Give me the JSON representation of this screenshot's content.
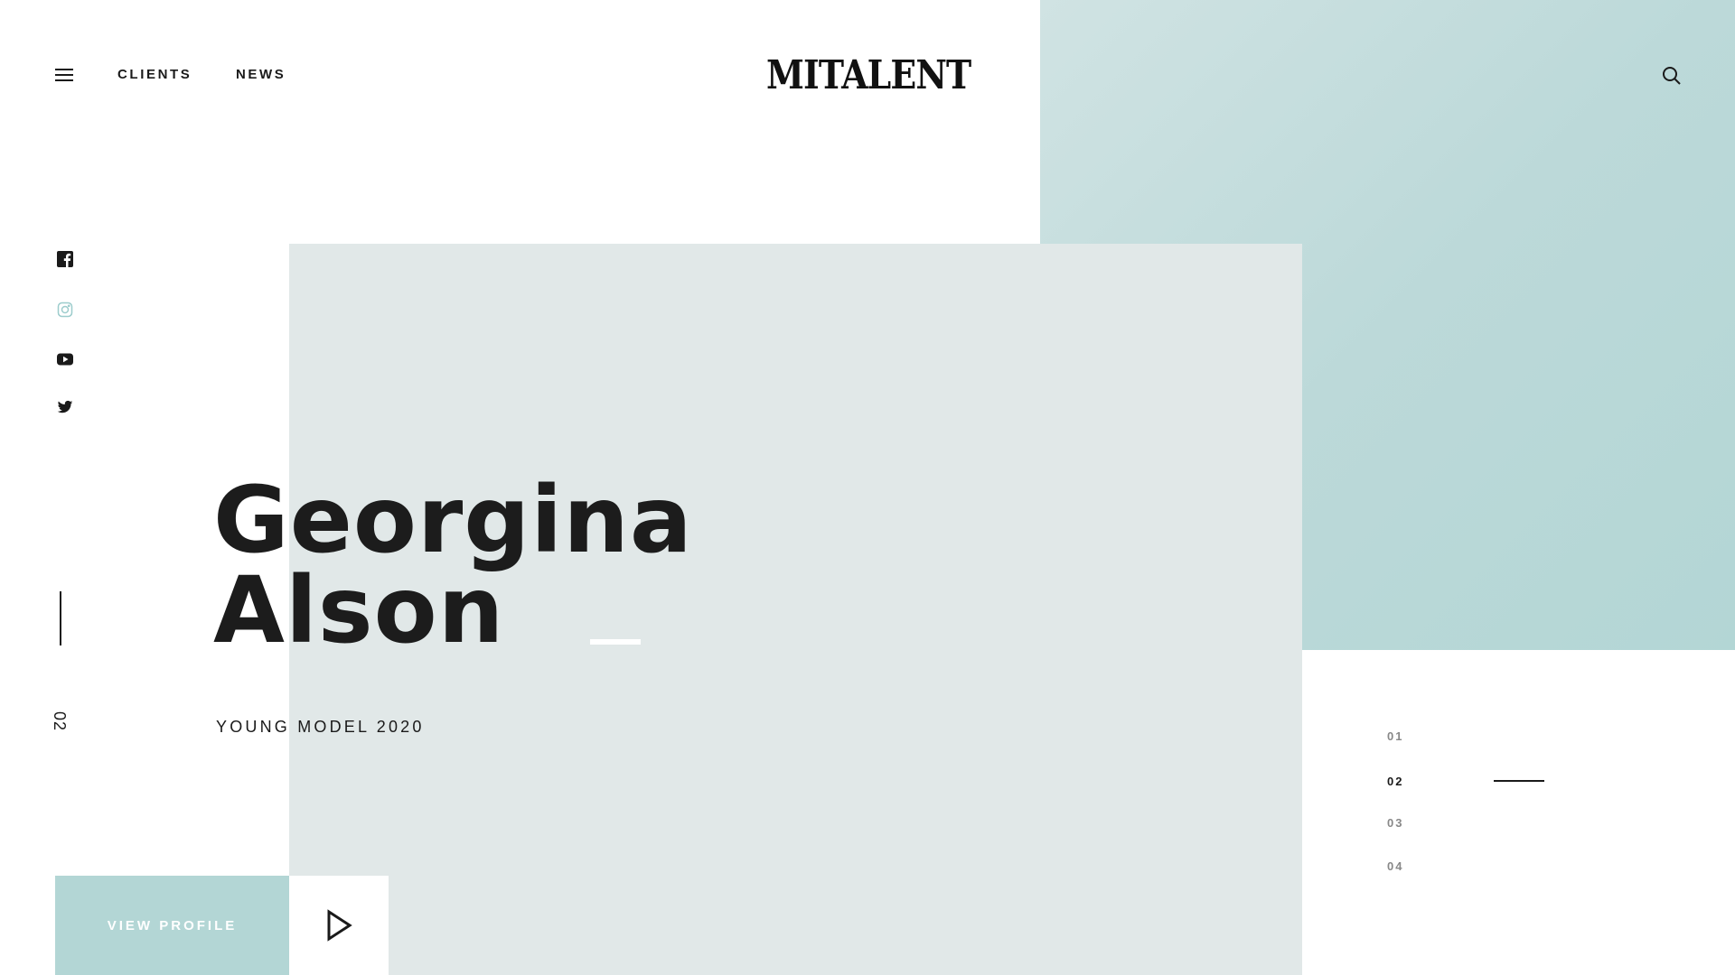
{
  "header": {
    "menu_icon": "hamburger-icon",
    "nav": [
      {
        "label": "CLIENTS"
      },
      {
        "label": "NEWS"
      }
    ],
    "logo": "MITALENT",
    "search_icon": "search-icon"
  },
  "social": [
    {
      "icon": "facebook-icon",
      "color": "#1a1a1a"
    },
    {
      "icon": "instagram-icon",
      "color": "#9ccccc"
    },
    {
      "icon": "youtube-icon",
      "color": "#1a1a1a"
    },
    {
      "icon": "twitter-icon",
      "color": "#1a1a1a"
    }
  ],
  "slide": {
    "current_number": "02"
  },
  "hero": {
    "first_name": "Georgina",
    "last_name": "Alson",
    "subtitle": "YOUNG MODEL 2020"
  },
  "cta": {
    "label": "VIEW PROFILE",
    "play_icon": "play-icon"
  },
  "pagination": [
    {
      "label": "01",
      "active": false
    },
    {
      "label": "02",
      "active": true
    },
    {
      "label": "03",
      "active": false
    },
    {
      "label": "04",
      "active": false
    }
  ],
  "colors": {
    "accent_teal": "#b3d6d5",
    "panel_grey": "#e1e8e8",
    "text_dark": "#1a1a1a"
  }
}
